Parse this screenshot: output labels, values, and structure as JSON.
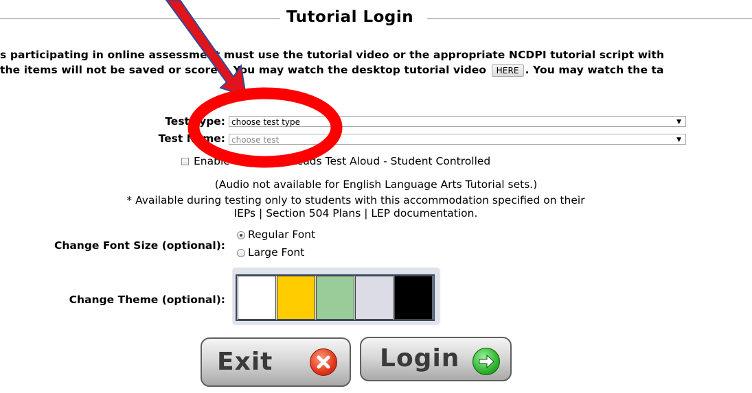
{
  "header": {
    "title": "Tutorial Login"
  },
  "intro": {
    "line1": "s participating in online assessment must use the tutorial video or the appropriate NCDPI tutorial script with",
    "line2_a": "the items will not be saved or scored. You may watch the desktop tutorial video",
    "here_label": "HERE",
    "line2_b": ". You may watch the ta"
  },
  "form": {
    "test_type": {
      "label": "Test Type:",
      "value": "choose test type"
    },
    "test_name": {
      "label": "Test Name:",
      "placeholder": "choose test"
    },
    "read_aloud_label": "Enable Computer Reads Test Aloud - Student Controlled",
    "audio_note": "(Audio not available for English Language Arts Tutorial sets.)",
    "accommodation_line1": "* Available during testing only to students with this accommodation specified on their",
    "accommodation_line2": "IEPs | Section 504 Plans | LEP documentation.",
    "font_size": {
      "label": "Change Font Size (optional):",
      "options": [
        "Regular Font",
        "Large Font"
      ],
      "selected": "Regular Font"
    },
    "theme": {
      "label": "Change Theme (optional):",
      "swatches": [
        "#ffffff",
        "#ffcc00",
        "#99cc99",
        "#dcdce6",
        "#000000"
      ]
    }
  },
  "buttons": {
    "exit_label": "Exit",
    "login_label": "Login"
  },
  "annotation": {
    "circle_color": "#ff0000",
    "arrow_color": "#e0141c",
    "arrow_outline": "#2f4a9a"
  }
}
